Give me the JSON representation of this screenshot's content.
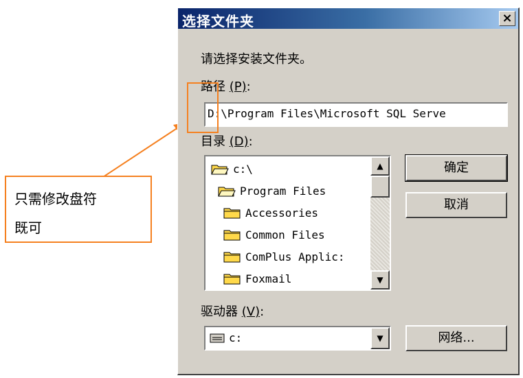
{
  "dialog": {
    "title": "选择文件夹",
    "close_label": "×",
    "prompt": "请选择安装文件夹。",
    "path_label": "路径",
    "path_mnemonic": "(P)",
    "path_suffix": ":",
    "path_value": "D:\\Program Files\\Microsoft SQL Serve",
    "dir_label": "目录",
    "dir_mnemonic": "(D)",
    "dir_suffix": ":",
    "folders": [
      {
        "name": "c:\\",
        "state": "open"
      },
      {
        "name": "Program Files",
        "state": "open"
      },
      {
        "name": "Accessories",
        "state": "closed"
      },
      {
        "name": "Common Files",
        "state": "closed"
      },
      {
        "name": "ComPlus Applic:",
        "state": "closed"
      },
      {
        "name": "Foxmail",
        "state": "closed"
      }
    ],
    "ok_label": "确定",
    "cancel_label": "取消",
    "drive_label": "驱动器",
    "drive_mnemonic": "(V)",
    "drive_suffix": ":",
    "drive_value": "c:",
    "network_label": "网络..."
  },
  "annotation": {
    "line1": "只需修改盘符",
    "line2": "既可",
    "color": "#f5801f"
  },
  "colors": {
    "face": "#d4d0c8",
    "title_start": "#0a246a",
    "title_end": "#a6caf0",
    "folder": "#ffd94a"
  }
}
